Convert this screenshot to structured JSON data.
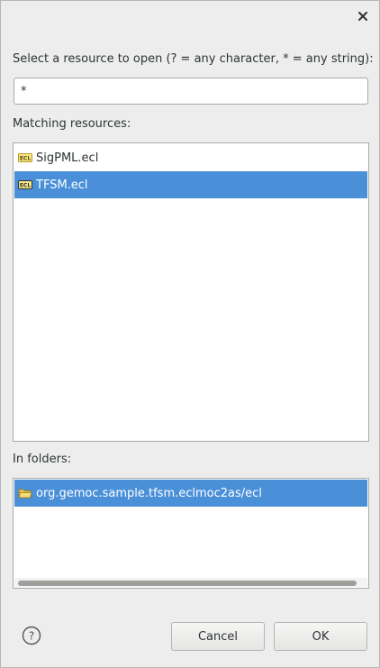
{
  "dialog": {
    "close_icon": "close-icon",
    "prompt_label": "Select a resource to open (? = any character, * = any string):",
    "search": {
      "value": "*",
      "placeholder": ""
    },
    "matching_label": "Matching resources:",
    "resources": [
      {
        "name": "SigPML.ecl",
        "icon": "ecl-file-icon",
        "selected": false
      },
      {
        "name": "TFSM.ecl",
        "icon": "ecl-file-icon",
        "selected": true
      }
    ],
    "folders_label": "In folders:",
    "folders": [
      {
        "path": "org.gemoc.sample.tfsm.eclmoc2as/ecl",
        "icon": "folder-icon",
        "selected": true
      }
    ],
    "buttons": {
      "help_icon": "help-icon",
      "cancel": "Cancel",
      "ok": "OK"
    },
    "colors": {
      "selection": "#4a90d9",
      "background": "#ededed"
    }
  }
}
